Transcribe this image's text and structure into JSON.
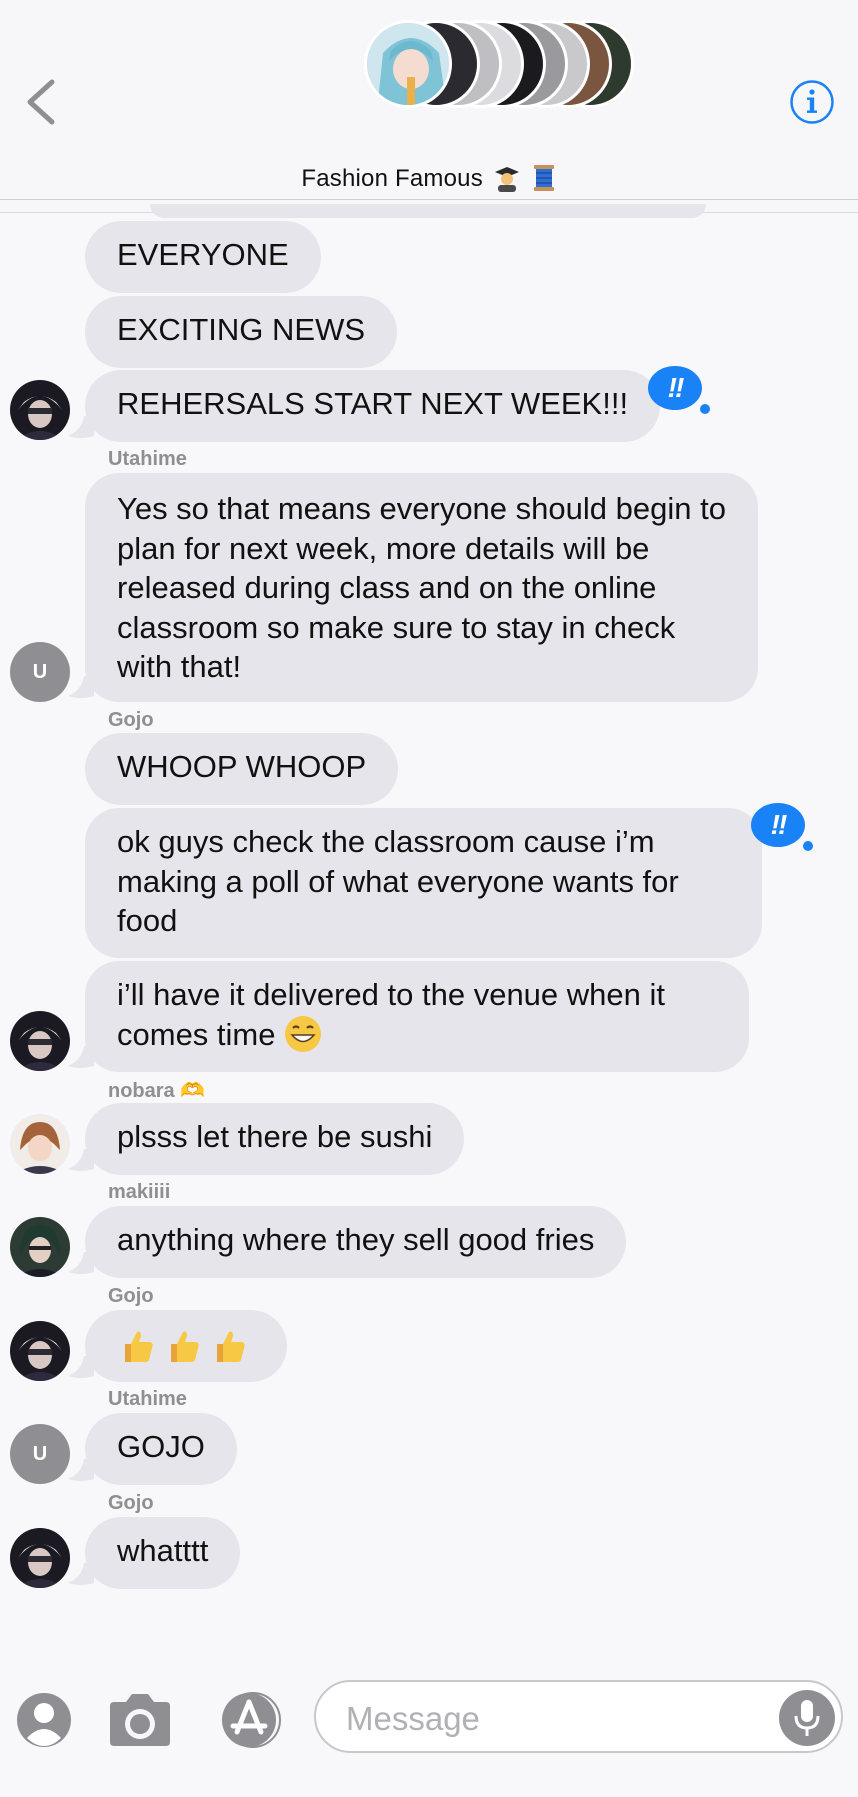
{
  "header": {
    "title": "Fashion Famous",
    "title_emoji": [
      "student-emoji",
      "thread-spool-emoji"
    ]
  },
  "messages": [
    {
      "text": "EVERYONE"
    },
    {
      "text": "EXCITING NEWS"
    },
    {
      "text": "REHERSALS START NEXT WEEK!!!",
      "reaction": "!!"
    },
    {
      "sender": "Utahime",
      "avatar_letter": "U",
      "text": "Yes so that means everyone should begin to plan for next week, more details will be released during class and on the online classroom so make sure to stay in check with that!"
    },
    {
      "sender": "Gojo",
      "text": "WHOOP WHOOP"
    },
    {
      "text": "ok guys check the classroom cause i’m making a poll of what everyone wants for food",
      "reaction": "!!"
    },
    {
      "text": "i’ll have it delivered to the venue when it comes time"
    },
    {
      "sender": "nobara 🫶",
      "text": "plsss let there be sushi"
    },
    {
      "sender": "makiiii",
      "text": "anything where they sell good fries"
    },
    {
      "sender": "Gojo",
      "text": "thumbs-up x3"
    },
    {
      "sender": "Utahime",
      "avatar_letter": "U",
      "text": "GOJO"
    },
    {
      "sender": "Gojo",
      "text": "whatttt"
    }
  ],
  "composer": {
    "placeholder": "Message"
  },
  "colors": {
    "bubble": "#e6e5eb",
    "accent": "#1a82f7",
    "secondary_text": "#8e8e93"
  }
}
